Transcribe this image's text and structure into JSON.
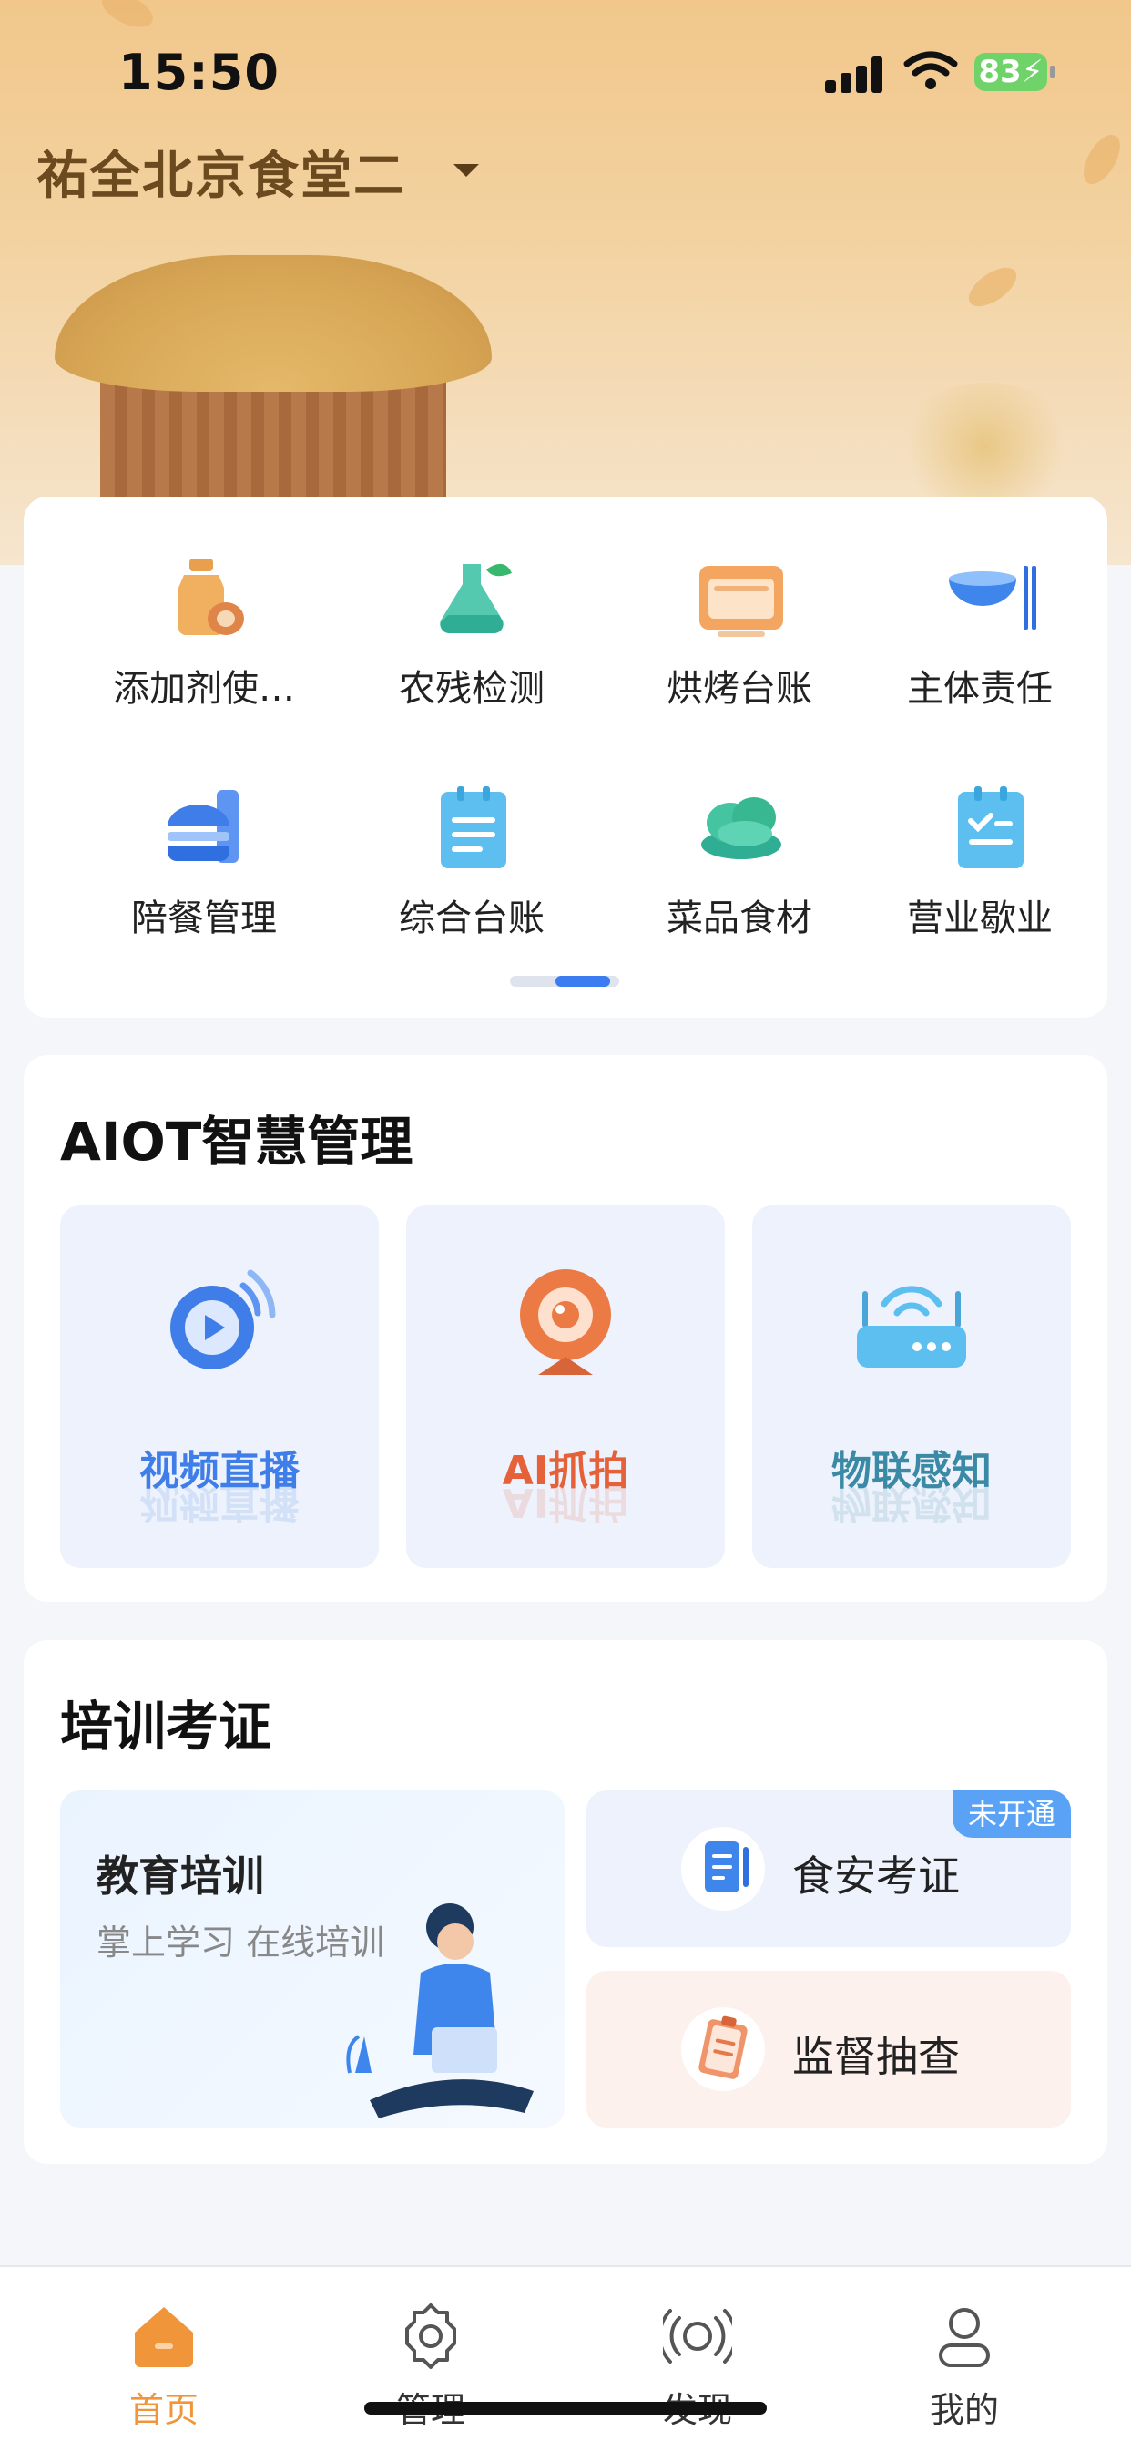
{
  "status": {
    "time": "15:50",
    "battery": "83"
  },
  "location": {
    "name": "祐全北京食堂二"
  },
  "quick_grid": {
    "items": [
      {
        "label": "添加剂使…",
        "icon": "additive-bottle-icon"
      },
      {
        "label": "农残检测",
        "icon": "flask-leaf-icon"
      },
      {
        "label": "烘烤台账",
        "icon": "oven-icon"
      },
      {
        "label": "主体责任",
        "icon": "bowl-chopsticks-icon"
      },
      {
        "label": "陪餐管理",
        "icon": "burger-drink-icon"
      },
      {
        "label": "综合台账",
        "icon": "clipboard-icon"
      },
      {
        "label": "菜品食材",
        "icon": "vegetable-icon"
      },
      {
        "label": "营业歇业",
        "icon": "clipboard-check-icon"
      }
    ]
  },
  "aiot": {
    "title": "AIOT智慧管理",
    "tiles": [
      {
        "label": "视频直播",
        "color": "#3f7ee8",
        "icon": "video-live-icon"
      },
      {
        "label": "AI抓拍",
        "color": "#e5613a",
        "icon": "webcam-icon"
      },
      {
        "label": "物联感知",
        "color": "#3a8aa6",
        "icon": "router-icon"
      }
    ]
  },
  "training": {
    "title": "培训考证",
    "edu": {
      "title": "教育培训",
      "subtitle": "掌上学习 在线培训"
    },
    "exam": {
      "label": "食安考证",
      "badge": "未开通"
    },
    "inspect": {
      "label": "监督抽查"
    }
  },
  "tabbar": {
    "items": [
      {
        "label": "首页",
        "active": true,
        "color": "#f0953a"
      },
      {
        "label": "管理",
        "active": false
      },
      {
        "label": "发现",
        "active": false
      },
      {
        "label": "我的",
        "active": false
      }
    ]
  }
}
